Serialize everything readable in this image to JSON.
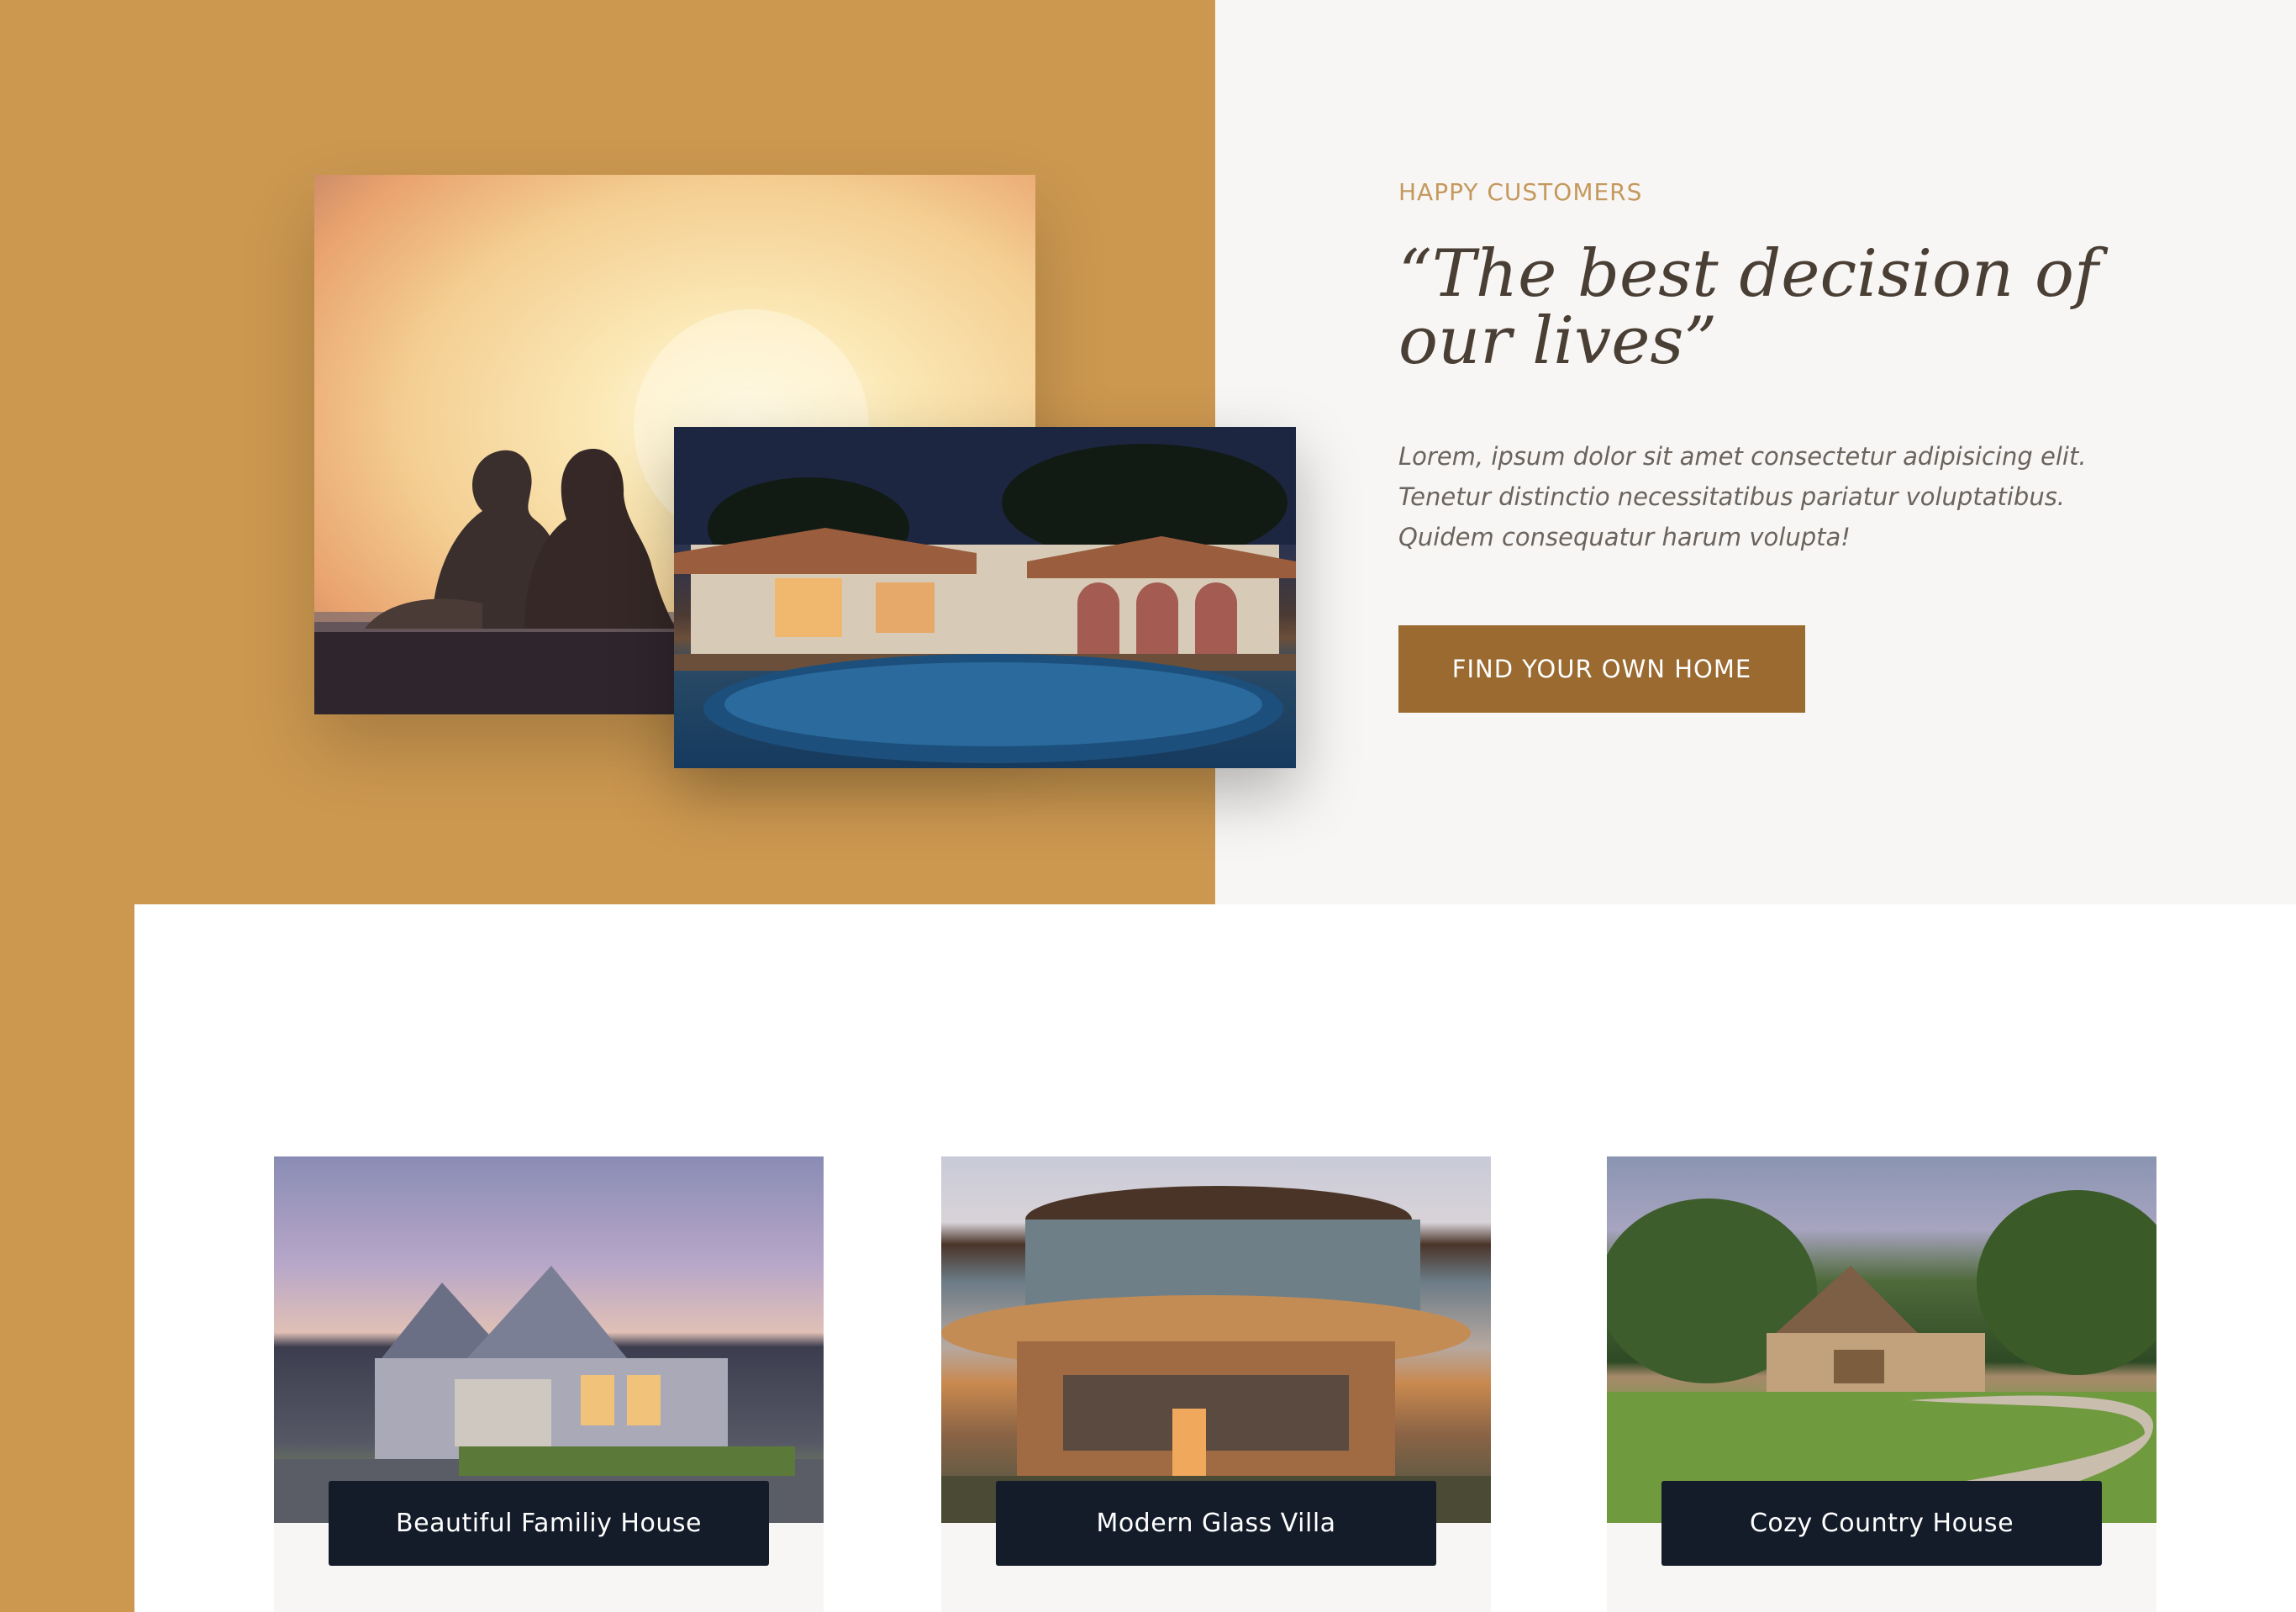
{
  "testimonial": {
    "eyebrow": "HAPPY CUSTOMERS",
    "quote": "“The best decision of our lives”",
    "body": "Lorem, ipsum dolor sit amet consectetur adipisicing elit. Tenetur distinctio necessitatibus pariatur voluptatibus. Quidem consequatur harum volupta!",
    "cta_label": "FIND YOUR OWN HOME"
  },
  "homes": [
    {
      "name": "Beautiful Familiy House"
    },
    {
      "name": "Modern Glass Villa"
    },
    {
      "name": "Cozy Country House"
    }
  ],
  "colors": {
    "accent_gold": "#cc9850",
    "button_brown": "#9a6a31",
    "label_navy": "#141c2a",
    "eyebrow_gold": "#c4995e",
    "heading_text": "#4a3f35"
  }
}
